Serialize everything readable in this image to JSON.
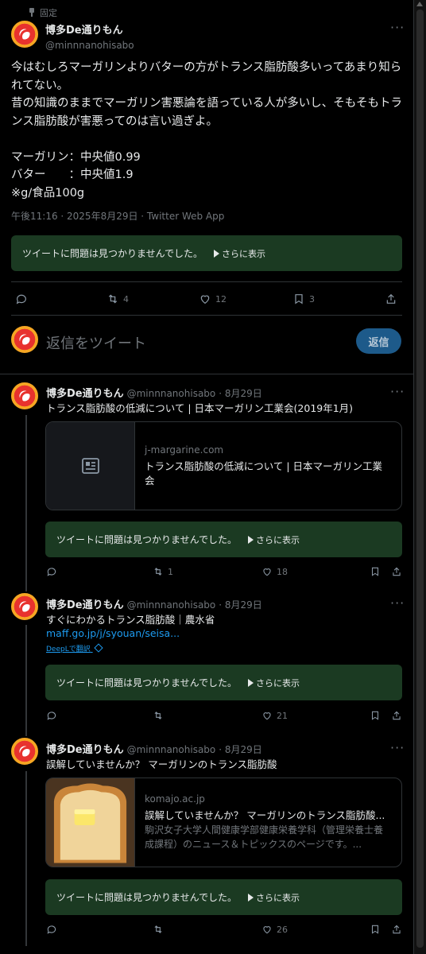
{
  "pinned_label": "固定",
  "main_tweet": {
    "name": "博多De通りもん",
    "handle": "@minnnanohisabo",
    "text": "今はむしろマーガリンよりバターの方がトランス脂肪酸多いってあまり知られてない。\n昔の知識のままでマーガリン害悪論を語っている人が多いし、そもそもトランス脂肪酸が害悪ってのは言い過ぎよ。\n\nマーガリン：中央値0.99\nバター　　：中央値1.9\n※g/食品100g",
    "meta": "午後11:16 · 2025年8月29日 · Twitter Web App",
    "note_text": "ツイートに問題は見つかりませんでした。",
    "note_more": "さらに表示",
    "retweets": "4",
    "likes": "12",
    "bookmarks": "3"
  },
  "reply_box": {
    "placeholder": "返信をツイート",
    "button": "返信"
  },
  "replies": [
    {
      "name": "博多De通りもん",
      "handle": "@minnnanohisabo",
      "date": "· 8月29日",
      "text": "トランス脂肪酸の低減について | 日本マーガリン工業会(2019年1月)",
      "card_domain": "j-margarine.com",
      "card_title": "トランス脂肪酸の低減について | 日本マーガリン工業会",
      "note_text": "ツイートに問題は見つかりませんでした。",
      "note_more": "さらに表示",
      "retweets": "1",
      "likes": "18"
    },
    {
      "name": "博多De通りもん",
      "handle": "@minnnanohisabo",
      "date": "· 8月29日",
      "text": "すぐにわかるトランス脂肪酸｜農水省",
      "link": "maff.go.jp/j/syouan/seisa...",
      "deepl": "DeepLで翻訳",
      "note_text": "ツイートに問題は見つかりませんでした。",
      "note_more": "さらに表示",
      "retweets": "",
      "likes": "21"
    },
    {
      "name": "博多De通りもん",
      "handle": "@minnnanohisabo",
      "date": "· 8月29日",
      "text": "誤解していませんか？ マーガリンのトランス脂肪酸",
      "card_domain": "komajo.ac.jp",
      "card_title": "誤解していませんか？ マーガリンのトランス脂肪酸...",
      "card_desc": "駒沢女子大学人間健康学部健康栄養学科（管理栄養士養成課程）のニュース＆トピックスのページです。...",
      "note_text": "ツイートに問題は見つかりませんでした。",
      "note_more": "さらに表示",
      "retweets": "",
      "likes": "26"
    }
  ],
  "colors": {
    "background": "#000000",
    "note_bg": "#1b3a22",
    "link": "#1d9bf0",
    "reply_button": "#1d5a8a"
  }
}
